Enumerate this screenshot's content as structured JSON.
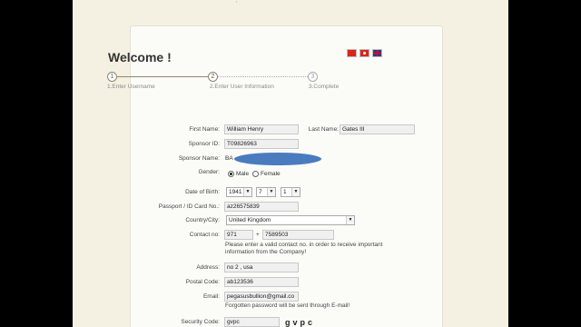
{
  "page": {
    "welcome": "Welcome !",
    "stray_mark": "˛"
  },
  "languages": [
    {
      "name": "cn-flag-icon"
    },
    {
      "name": "hk-flag-icon"
    },
    {
      "name": "uk-flag-icon"
    }
  ],
  "steps": [
    {
      "num": "1",
      "label": "1.Enter Username"
    },
    {
      "num": "2",
      "label": "2.Enter User Information"
    },
    {
      "num": "3",
      "label": "3.Complete"
    }
  ],
  "form": {
    "first_name_label": "First Name:",
    "first_name_value": "William Henry",
    "last_name_label": "Last Name:",
    "last_name_value": "Gates III",
    "sponsor_id_label": "Sponsor ID:",
    "sponsor_id_value": "T09826963",
    "sponsor_name_label": "Sponsor Name:",
    "sponsor_name_prefix": "BA",
    "gender_label": "Gender:",
    "gender_male": "Male",
    "gender_female": "Female",
    "dob_label": "Date of Birth:",
    "dob_year": "1941",
    "dob_month": "7",
    "dob_day": "1",
    "passport_label": "Passport / ID Card No.:",
    "passport_value": "az26575839",
    "country_label": "Country/City:",
    "country_value": "United Kingdom",
    "contact_label": "Contact no:",
    "contact_code": "971",
    "contact_plus": "+",
    "contact_number": "7589503",
    "contact_note": "Please enter a valid contact no. in order to receive important information from the Company!",
    "address_label": "Address:",
    "address_value": "no 2 , usa",
    "postal_label": "Postal Code:",
    "postal_value": "ab123536",
    "email_label": "Email:",
    "email_value": "pegasusbullion@gmail.co",
    "email_note": "Forgotten password will be sent through E-mail!",
    "security_label": "Security Code:",
    "security_value": "gvpc",
    "captcha_text": "gvpc"
  }
}
